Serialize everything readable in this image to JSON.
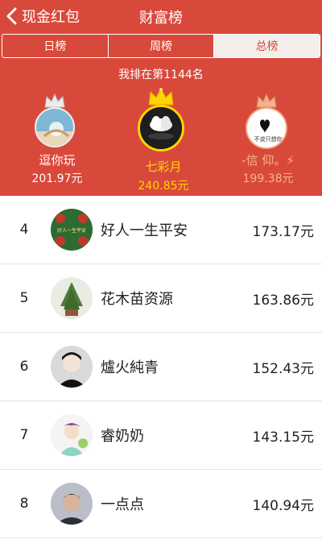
{
  "nav": {
    "back_label": "现金红包",
    "title": "财富榜"
  },
  "tabs": [
    {
      "label": "日榜",
      "active": false
    },
    {
      "label": "周榜",
      "active": false
    },
    {
      "label": "总榜",
      "active": true
    }
  ],
  "my_rank_text": "我排在第1144名",
  "podium": {
    "first": {
      "name": "七彩月",
      "amount": "240.85元"
    },
    "second": {
      "name": "逗你玩",
      "amount": "201.97元"
    },
    "third": {
      "name": "-信  仰。⚡",
      "amount": "199.38元",
      "avatar_text": "不说只想你"
    }
  },
  "list": [
    {
      "rank": "4",
      "name": "好人一生平安",
      "amount": "173.17元",
      "avatar_text": "好人一生平安"
    },
    {
      "rank": "5",
      "name": "花木苗资源",
      "amount": "163.86元"
    },
    {
      "rank": "6",
      "name": "爐火純青",
      "amount": "152.43元"
    },
    {
      "rank": "7",
      "name": "睿奶奶",
      "amount": "143.15元"
    },
    {
      "rank": "8",
      "name": "一点点",
      "amount": "140.94元"
    }
  ],
  "colors": {
    "header_bg": "#d9493b",
    "gold": "#ffd400",
    "bronze": "#f7b48b",
    "tab_active_bg": "#f4efed"
  }
}
